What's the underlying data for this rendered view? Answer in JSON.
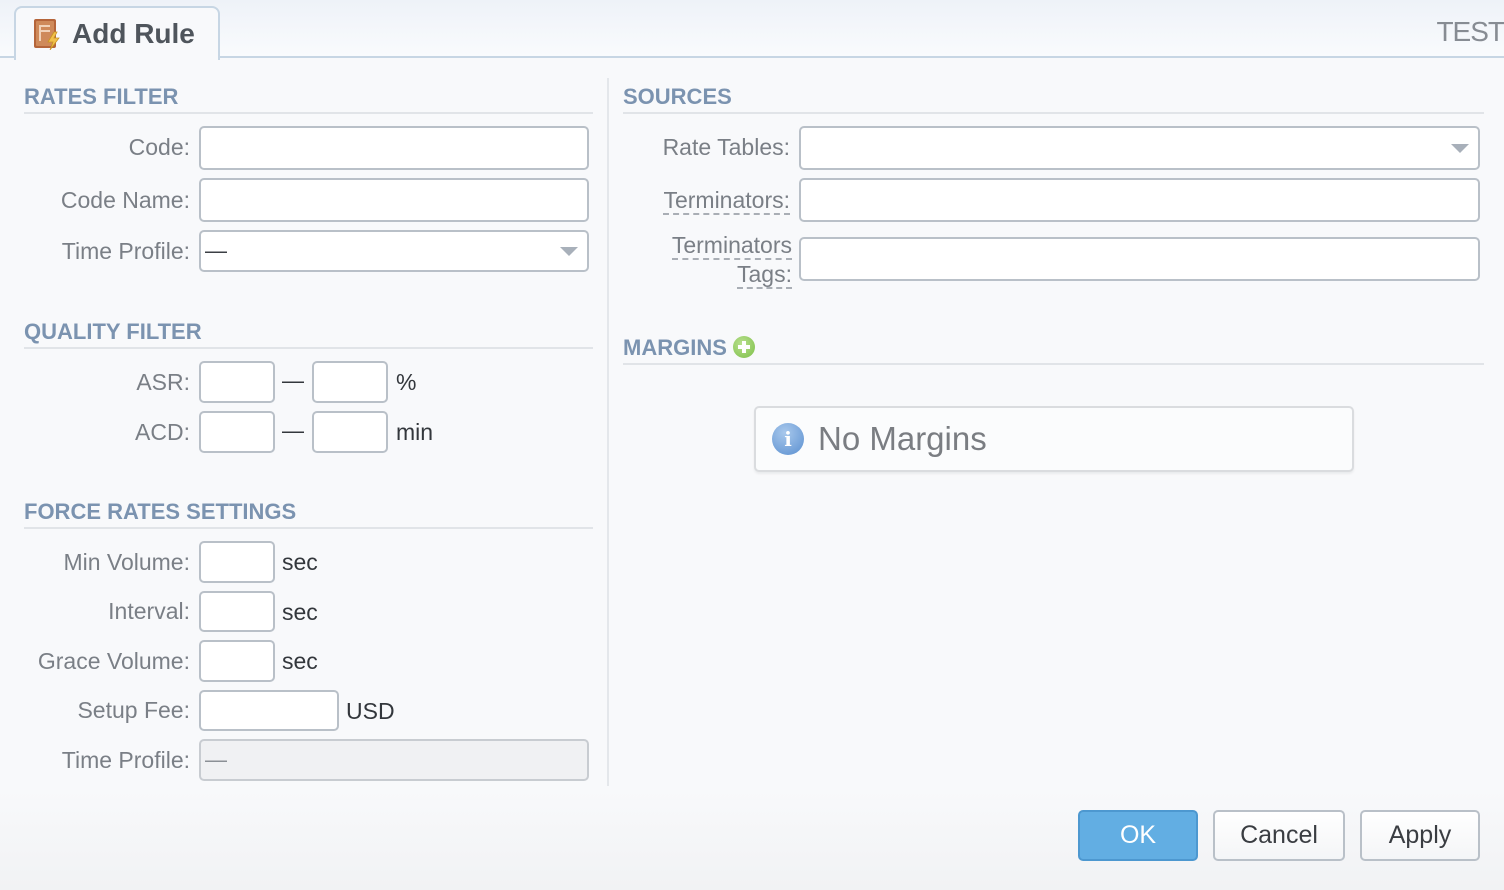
{
  "window": {
    "tab_title": "Add Rule",
    "tab_icon": "rule-book-icon",
    "right_label": "TEST"
  },
  "rates_filter": {
    "title": "RATES FILTER",
    "code_label": "Code:",
    "code_value": "",
    "code_name_label": "Code Name:",
    "code_name_value": "",
    "time_profile_label": "Time Profile:",
    "time_profile_value": "—"
  },
  "quality_filter": {
    "title": "QUALITY FILTER",
    "asr_label": "ASR:",
    "asr_from": "",
    "asr_to": "",
    "asr_unit": "%",
    "acd_label": "ACD:",
    "acd_from": "",
    "acd_to": "",
    "acd_unit": "min",
    "range_separator": "—"
  },
  "force_rates": {
    "title": "FORCE RATES SETTINGS",
    "min_volume_label": "Min Volume:",
    "min_volume_value": "",
    "min_volume_unit": "sec",
    "interval_label": "Interval:",
    "interval_value": "",
    "interval_unit": "sec",
    "grace_volume_label": "Grace Volume:",
    "grace_volume_value": "",
    "grace_volume_unit": "sec",
    "setup_fee_label": "Setup Fee:",
    "setup_fee_value": "",
    "setup_fee_unit": "USD",
    "time_profile_label": "Time Profile:",
    "time_profile_value": "—"
  },
  "sources": {
    "title": "SOURCES",
    "rate_tables_label": "Rate Tables:",
    "rate_tables_value": "",
    "terminators_label": "Terminators:",
    "terminators_value": "",
    "terminators_tags_label_1": "Terminators",
    "terminators_tags_label_2": "Tags:",
    "terminators_tags_value": ""
  },
  "margins": {
    "title": "MARGINS",
    "add_icon": "plus-circle-icon",
    "empty_message": "No Margins"
  },
  "footer": {
    "ok_label": "OK",
    "cancel_label": "Cancel",
    "apply_label": "Apply"
  }
}
